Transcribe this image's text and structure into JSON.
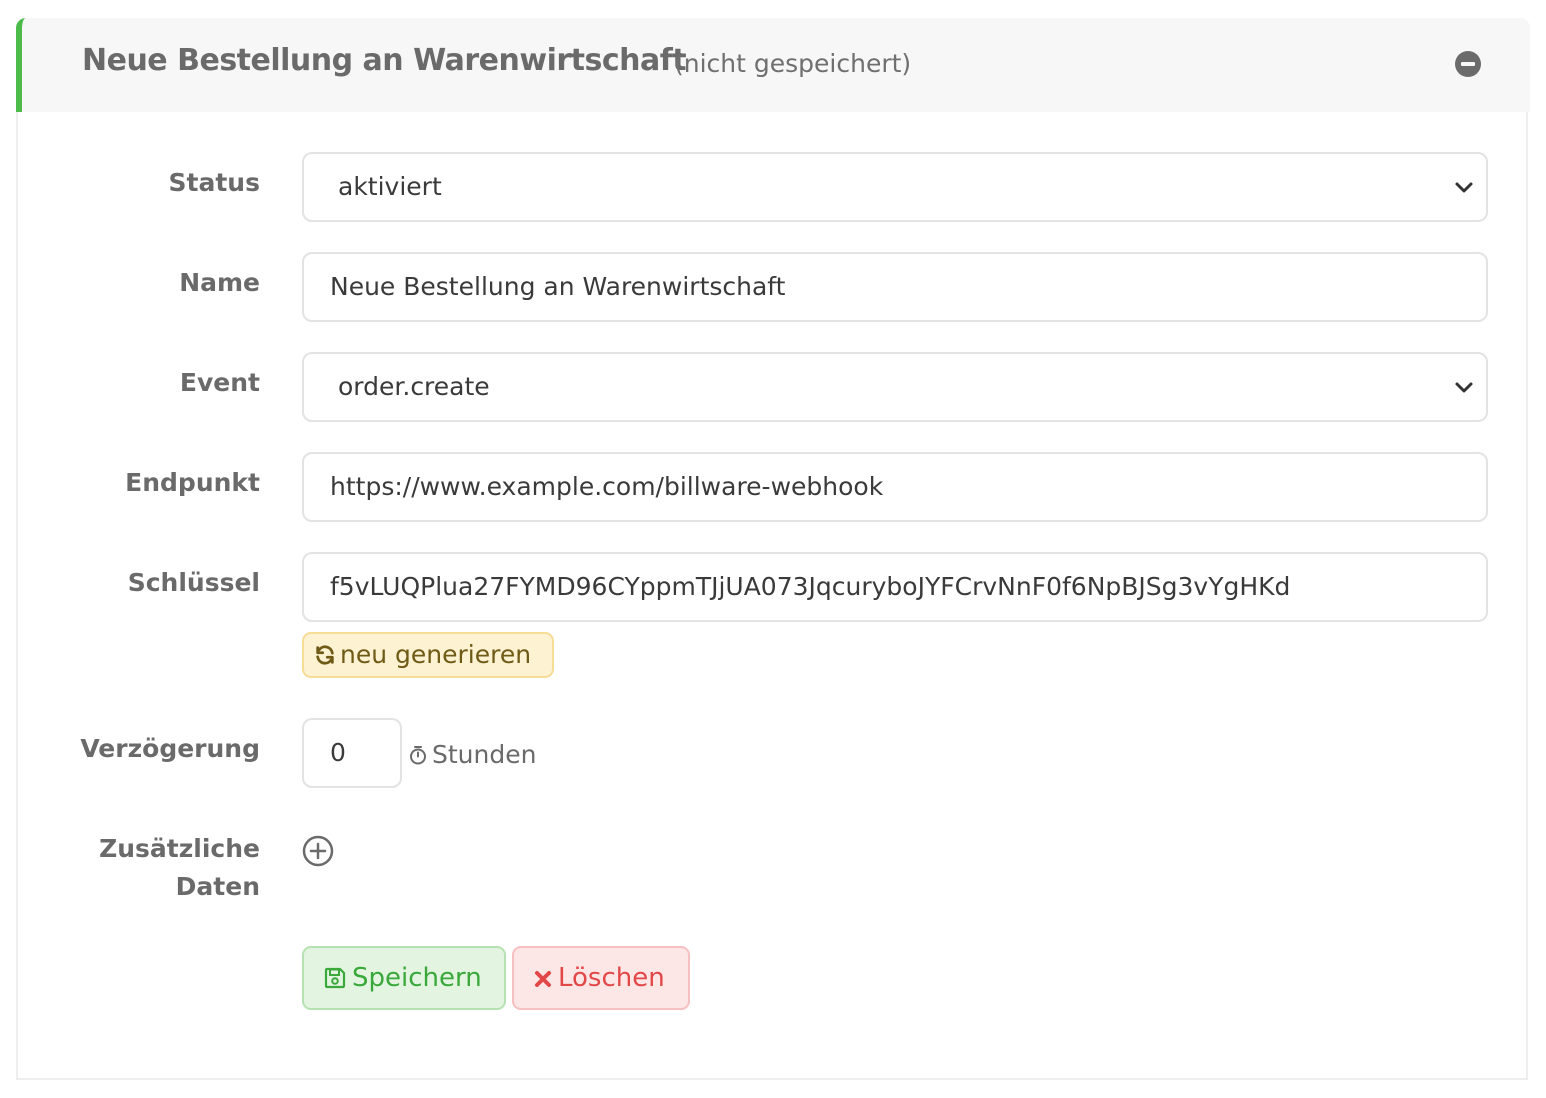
{
  "header": {
    "title": "Neue Bestellung an Warenwirtschaft",
    "subtitle": "(nicht gespeichert)",
    "accent_color": "#4cbb4c"
  },
  "form": {
    "status": {
      "label": "Status",
      "value": "aktiviert"
    },
    "name": {
      "label": "Name",
      "value": "Neue Bestellung an Warenwirtschaft"
    },
    "event": {
      "label": "Event",
      "value": "order.create"
    },
    "endpoint": {
      "label": "Endpunkt",
      "value": "https://www.example.com/billware-webhook"
    },
    "key": {
      "label": "Schlüssel",
      "value": "f5vLUQPlua27FYMD96CYppmTJjUA073JqcuryboJYFCrvNnF0f6NpBJSg3vYgHKd",
      "regenerate_label": "neu generieren"
    },
    "delay": {
      "label": "Verzögerung",
      "value": "0",
      "unit": "Stunden"
    },
    "extra_data": {
      "label_line1": "Zusätzliche",
      "label_line2": "Daten"
    }
  },
  "actions": {
    "save_label": "Speichern",
    "delete_label": "Löschen"
  },
  "icons": {
    "collapse": "minus-circle-icon",
    "select": "chevron-down-icon",
    "regenerate": "refresh-icon",
    "delay": "stopwatch-icon",
    "add": "plus-circle-icon",
    "save": "floppy-disk-icon",
    "delete": "x-icon"
  }
}
